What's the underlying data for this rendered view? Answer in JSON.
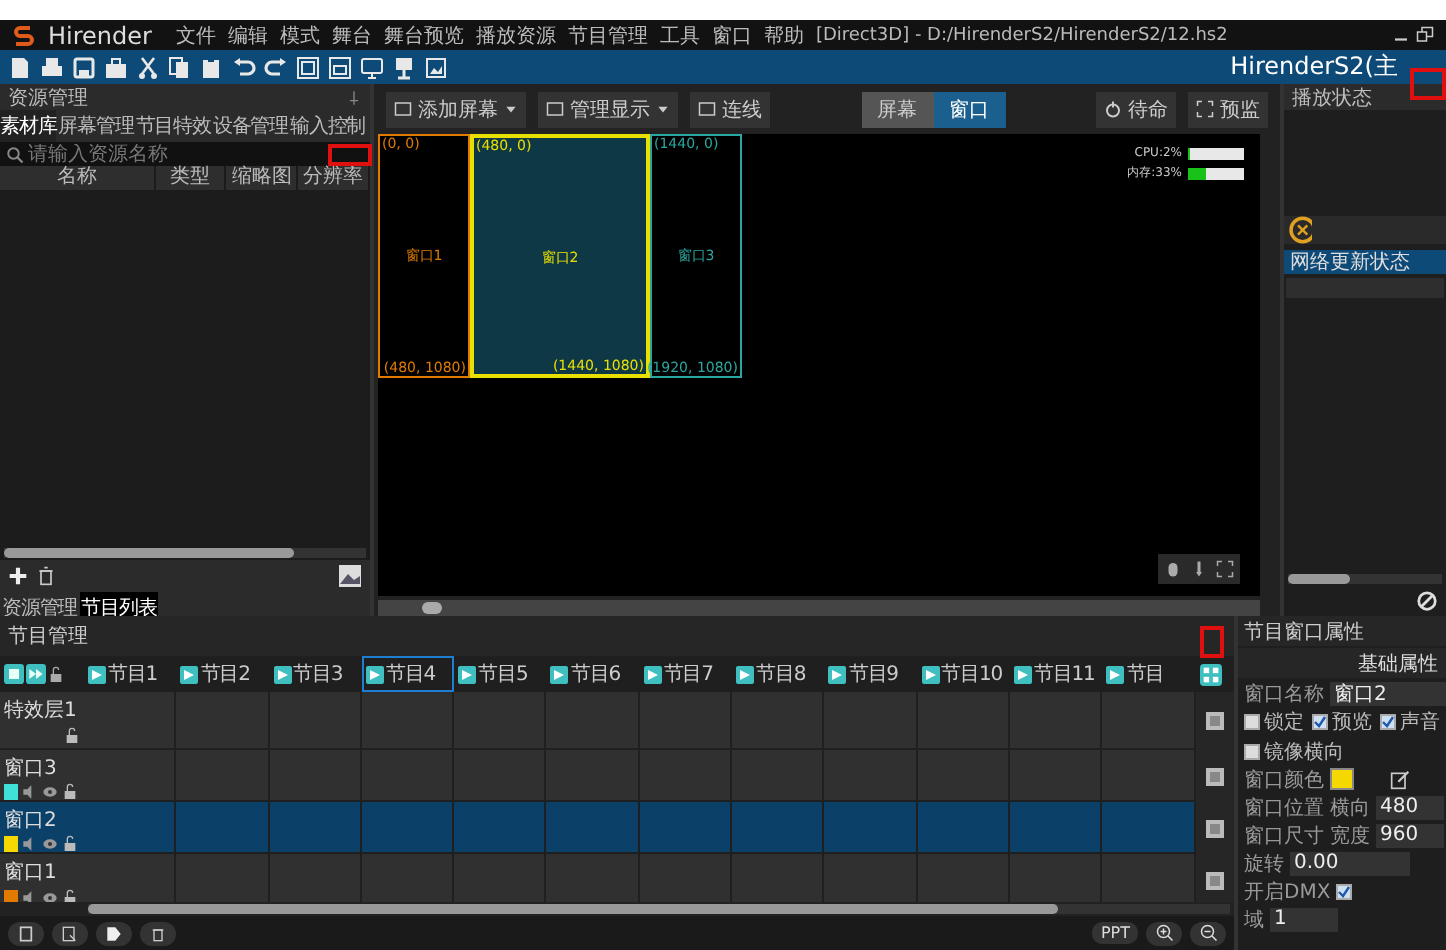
{
  "title_bar": {
    "app_name": "Hirender",
    "menu": [
      "文件",
      "编辑",
      "模式",
      "舞台",
      "舞台预览",
      "播放资源",
      "节目管理",
      "工具",
      "窗口",
      "帮助"
    ],
    "path": "[Direct3D] - D:/HirenderS2/HirenderS2/12.hs2"
  },
  "toolbar": {
    "brand": "HirenderS2(主"
  },
  "resource_panel": {
    "title": "资源管理",
    "tabs": [
      {
        "label": "素材库",
        "selected": true
      },
      {
        "label": "屏幕管理",
        "selected": false
      },
      {
        "label": "节目特效",
        "selected": false
      },
      {
        "label": "设备管理",
        "selected": false
      },
      {
        "label": "输入控制",
        "selected": false
      }
    ],
    "search": {
      "placeholder": "请输入资源名称"
    },
    "columns": [
      "名称",
      "类型",
      "缩略图",
      "分辨率"
    ],
    "bottom_tabs": [
      {
        "label": "资源管理",
        "selected": false
      },
      {
        "label": "节目列表",
        "selected": true
      }
    ]
  },
  "stage": {
    "tools": [
      {
        "label": "添加屏幕",
        "dropdown": true
      },
      {
        "label": "管理显示",
        "dropdown": true
      },
      {
        "label": "连线",
        "dropdown": false
      }
    ],
    "modes": [
      {
        "label": "屏幕",
        "selected": false
      },
      {
        "label": "窗口",
        "selected": true
      }
    ],
    "actions": [
      "待命",
      "预监"
    ],
    "meters": [
      {
        "label": "CPU:2%",
        "level": 0.02
      },
      {
        "label": "内存:33%",
        "level": 0.33
      }
    ],
    "windows": [
      {
        "name": "窗口1",
        "color": "#e07a00",
        "top_label": "(0, 0)",
        "bottom_label": "(480, 1080)",
        "selected": false
      },
      {
        "name": "窗口2",
        "color": "#e8e000",
        "top_label": "(480, 0)",
        "bottom_label": "(1440, 1080)",
        "selected": true
      },
      {
        "name": "窗口3",
        "color": "#2aa7a0",
        "top_label": "(1440, 0)",
        "bottom_label": "(1920, 1080)",
        "selected": false
      }
    ]
  },
  "status_panel": {
    "title": "播放状态",
    "network_title": "网络更新状态"
  },
  "program_manager": {
    "title": "节目管理",
    "programs": [
      {
        "label": "节目1",
        "selected": false
      },
      {
        "label": "节目2",
        "selected": false
      },
      {
        "label": "节目3",
        "selected": false
      },
      {
        "label": "节目4",
        "selected": true
      },
      {
        "label": "节目5",
        "selected": false
      },
      {
        "label": "节目6",
        "selected": false
      },
      {
        "label": "节目7",
        "selected": false
      },
      {
        "label": "节目8",
        "selected": false
      },
      {
        "label": "节目9",
        "selected": false
      },
      {
        "label": "节目10",
        "selected": false
      },
      {
        "label": "节目11",
        "selected": false
      },
      {
        "label": "节目",
        "selected": false
      }
    ],
    "layers": [
      {
        "name": "特效层1",
        "kind": "effect",
        "selected": false
      },
      {
        "name": "窗口3",
        "kind": "window",
        "color": "#40e0d8",
        "selected": false
      },
      {
        "name": "窗口2",
        "kind": "window",
        "color": "#f5d800",
        "selected": true
      },
      {
        "name": "窗口1",
        "kind": "window",
        "color": "#e07a00",
        "selected": false
      }
    ],
    "ppt": "PPT"
  },
  "properties": {
    "title": "节目窗口属性",
    "section": "基础属性",
    "name_label": "窗口名称",
    "name_value": "窗口2",
    "options": [
      {
        "label": "锁定",
        "checked": false
      },
      {
        "label": "预览",
        "checked": true
      },
      {
        "label": "声音",
        "checked": true
      },
      {
        "label": "镜像横向",
        "checked": false
      }
    ],
    "color_label": "窗口颜色",
    "color": "#f5d800",
    "position": {
      "label": "窗口位置",
      "axis": "横向",
      "value": "480"
    },
    "size": {
      "label": "窗口尺寸",
      "axis": "宽度",
      "value": "960"
    },
    "rotation": {
      "label": "旋转",
      "value": "0.00"
    },
    "dmx": {
      "label": "开启DMX",
      "checked": true
    },
    "domain": {
      "label": "域",
      "value": "1"
    }
  }
}
